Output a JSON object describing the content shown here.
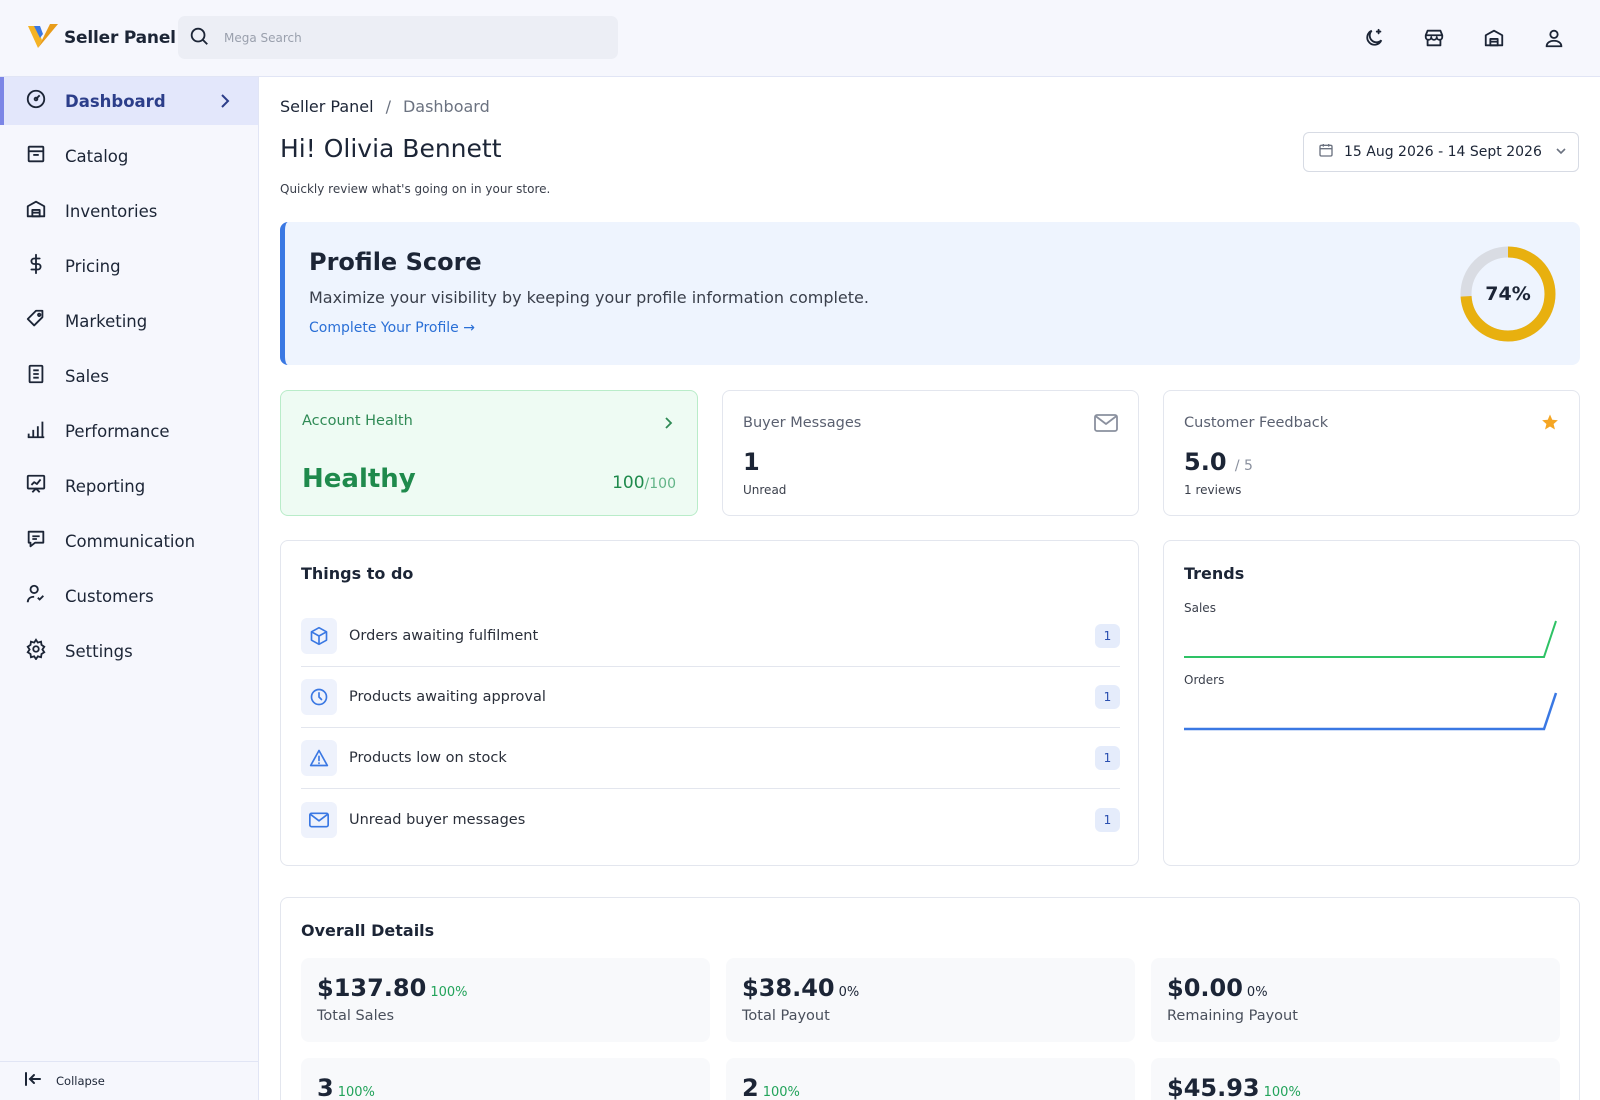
{
  "app": {
    "brand_name": "Seller Panel"
  },
  "search": {
    "placeholder": "Mega Search"
  },
  "header_icons": [
    "moon-icon",
    "store-icon",
    "warehouse-icon",
    "user-icon"
  ],
  "sidebar": {
    "items": [
      {
        "label": "Dashboard",
        "icon": "gauge-icon",
        "active": true
      },
      {
        "label": "Catalog",
        "icon": "catalog-icon"
      },
      {
        "label": "Inventories",
        "icon": "warehouse-icon"
      },
      {
        "label": "Pricing",
        "icon": "dollar-icon"
      },
      {
        "label": "Marketing",
        "icon": "tag-icon"
      },
      {
        "label": "Sales",
        "icon": "receipt-icon"
      },
      {
        "label": "Performance",
        "icon": "signal-icon"
      },
      {
        "label": "Reporting",
        "icon": "report-icon"
      },
      {
        "label": "Communication",
        "icon": "chat-icon"
      },
      {
        "label": "Customers",
        "icon": "customers-icon"
      },
      {
        "label": "Settings",
        "icon": "gear-icon"
      }
    ],
    "collapse_label": "Collapse"
  },
  "breadcrumb": {
    "root": "Seller Panel",
    "separator": "/",
    "current": "Dashboard"
  },
  "greeting": "Hi! Olivia Bennett",
  "subtitle": "Quickly review what's going on in your store.",
  "date_range": "15 Aug 2026 - 14 Sept 2026",
  "profile_score": {
    "title": "Profile Score",
    "description": "Maximize your visibility by keeping your profile information complete.",
    "link": "Complete Your Profile →",
    "percent": 74,
    "percent_label": "74%",
    "colors": {
      "progress": "#e8b00f",
      "track": "#d9dce3"
    }
  },
  "account_health": {
    "title": "Account Health",
    "status": "Healthy",
    "score": "100",
    "score_max": "/100"
  },
  "buyer_messages": {
    "title": "Buyer Messages",
    "value": "1",
    "caption": "Unread"
  },
  "customer_feedback": {
    "title": "Customer Feedback",
    "rating": "5.0",
    "rating_max": "/ 5",
    "caption": "1 reviews"
  },
  "todo": {
    "title": "Things to do",
    "items": [
      {
        "label": "Orders awaiting fulfilment",
        "count": "1",
        "icon": "box-icon"
      },
      {
        "label": "Products awaiting approval",
        "count": "1",
        "icon": "clock-icon"
      },
      {
        "label": "Products low on stock",
        "count": "1",
        "icon": "warning-icon"
      },
      {
        "label": "Unread buyer messages",
        "count": "1",
        "icon": "mail-icon"
      }
    ]
  },
  "trends": {
    "title": "Trends",
    "sales_label": "Sales",
    "orders_label": "Orders",
    "colors": {
      "sales": "#2ec265",
      "orders": "#3a78e3"
    }
  },
  "overall": {
    "title": "Overall Details",
    "stats": [
      {
        "value": "$137.80",
        "change": "100%",
        "label": "Total Sales",
        "tone": "green"
      },
      {
        "value": "$38.40",
        "change": "0%",
        "label": "Total Payout",
        "tone": "grey"
      },
      {
        "value": "$0.00",
        "change": "0%",
        "label": "Remaining Payout",
        "tone": "grey"
      },
      {
        "value": "3",
        "change": "100%",
        "label": "",
        "tone": "green"
      },
      {
        "value": "2",
        "change": "100%",
        "label": "",
        "tone": "green"
      },
      {
        "value": "$45.93",
        "change": "100%",
        "label": "",
        "tone": "green"
      }
    ]
  }
}
